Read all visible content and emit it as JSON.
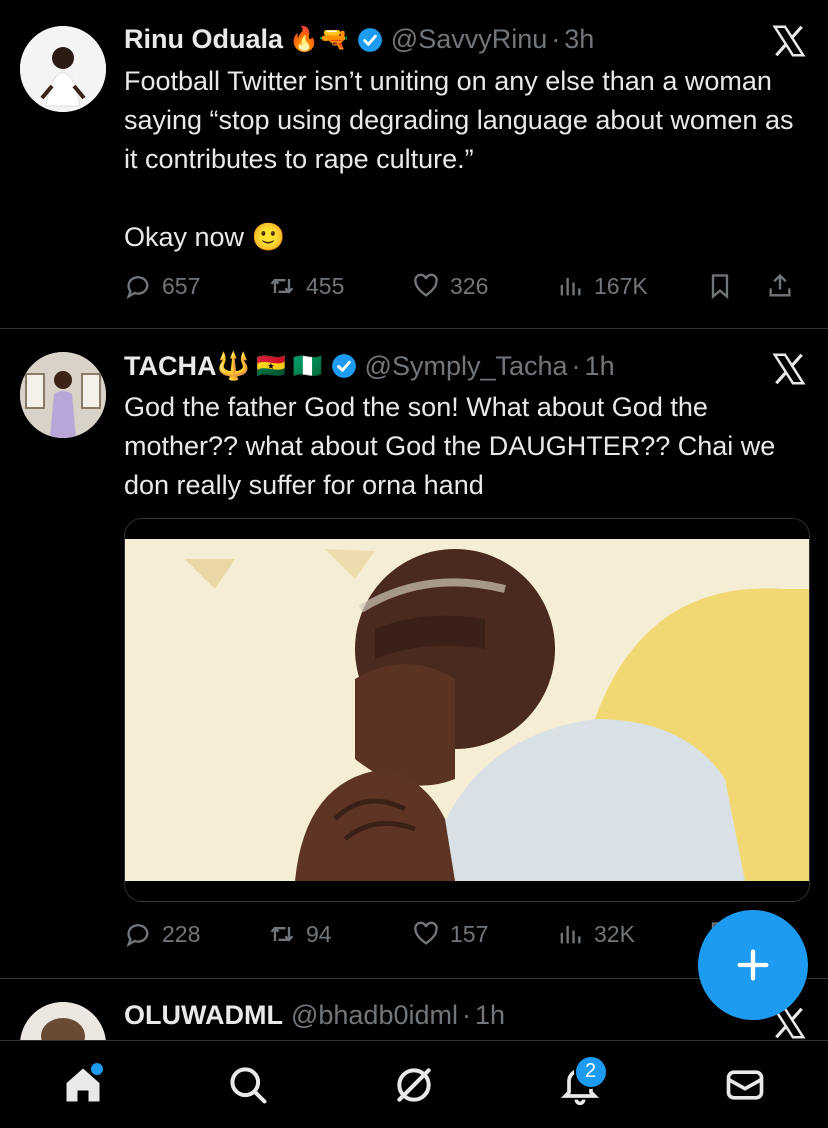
{
  "tweets": [
    {
      "name": "Rinu Oduala",
      "emojis": "🔥🔫",
      "handle": "@SavvyRinu",
      "time": "3h",
      "text": "Football Twitter isn’t uniting on any else than a woman saying “stop using degrading language about women as it contributes to rape culture.”\n\nOkay now 🙂",
      "replies": "657",
      "reposts": "455",
      "likes": "326",
      "views": "167K"
    },
    {
      "name": "TACHA🔱",
      "emojis": "🇬🇭 🇳🇬",
      "handle": "@Symply_Tacha",
      "time": "1h",
      "text": "God the father God the son! What about God the mother?? what about God the DAUGHTER?? Chai we don really suffer for orna hand",
      "replies": "228",
      "reposts": "94",
      "likes": "157",
      "views": "32K"
    },
    {
      "name": "OLUWADML",
      "handle": "@bhadb0idml",
      "time": "1h"
    }
  ],
  "nav": {
    "notifications_badge": "2"
  },
  "colors": {
    "accent": "#1d9bf0",
    "background": "#000000",
    "muted": "#71767b",
    "text": "#e7e9ea"
  }
}
